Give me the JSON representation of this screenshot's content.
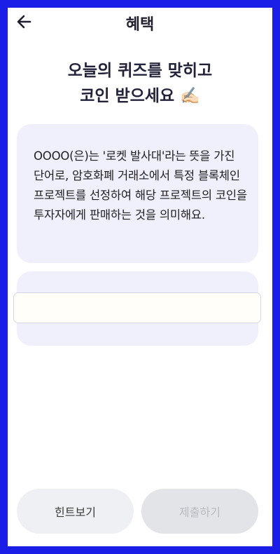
{
  "header": {
    "title": "혜택",
    "back_icon": "arrow-left-icon"
  },
  "heading": {
    "line1": "오늘의 퀴즈를 맞히고",
    "line2": "코인 받으세요 ✍🏻"
  },
  "quiz": {
    "question": "OOOO(은)는 '로켓 발사대'라는 뜻을 가진 단어로, 암호화폐 거래소에서 특정 블록체인 프로젝트를 선정하여 해당 프로젝트의 코인을 투자자에게 판매하는 것을 의미해요."
  },
  "answer": {
    "value": "",
    "placeholder": ""
  },
  "buttons": {
    "hint": "힌트보기",
    "submit": "제출하기"
  },
  "colors": {
    "frame_border": "#1a1ee6",
    "card_background": "#f0f0fd",
    "hint_button": "#eef0f3",
    "submit_button_disabled": "#e3e4e8"
  }
}
